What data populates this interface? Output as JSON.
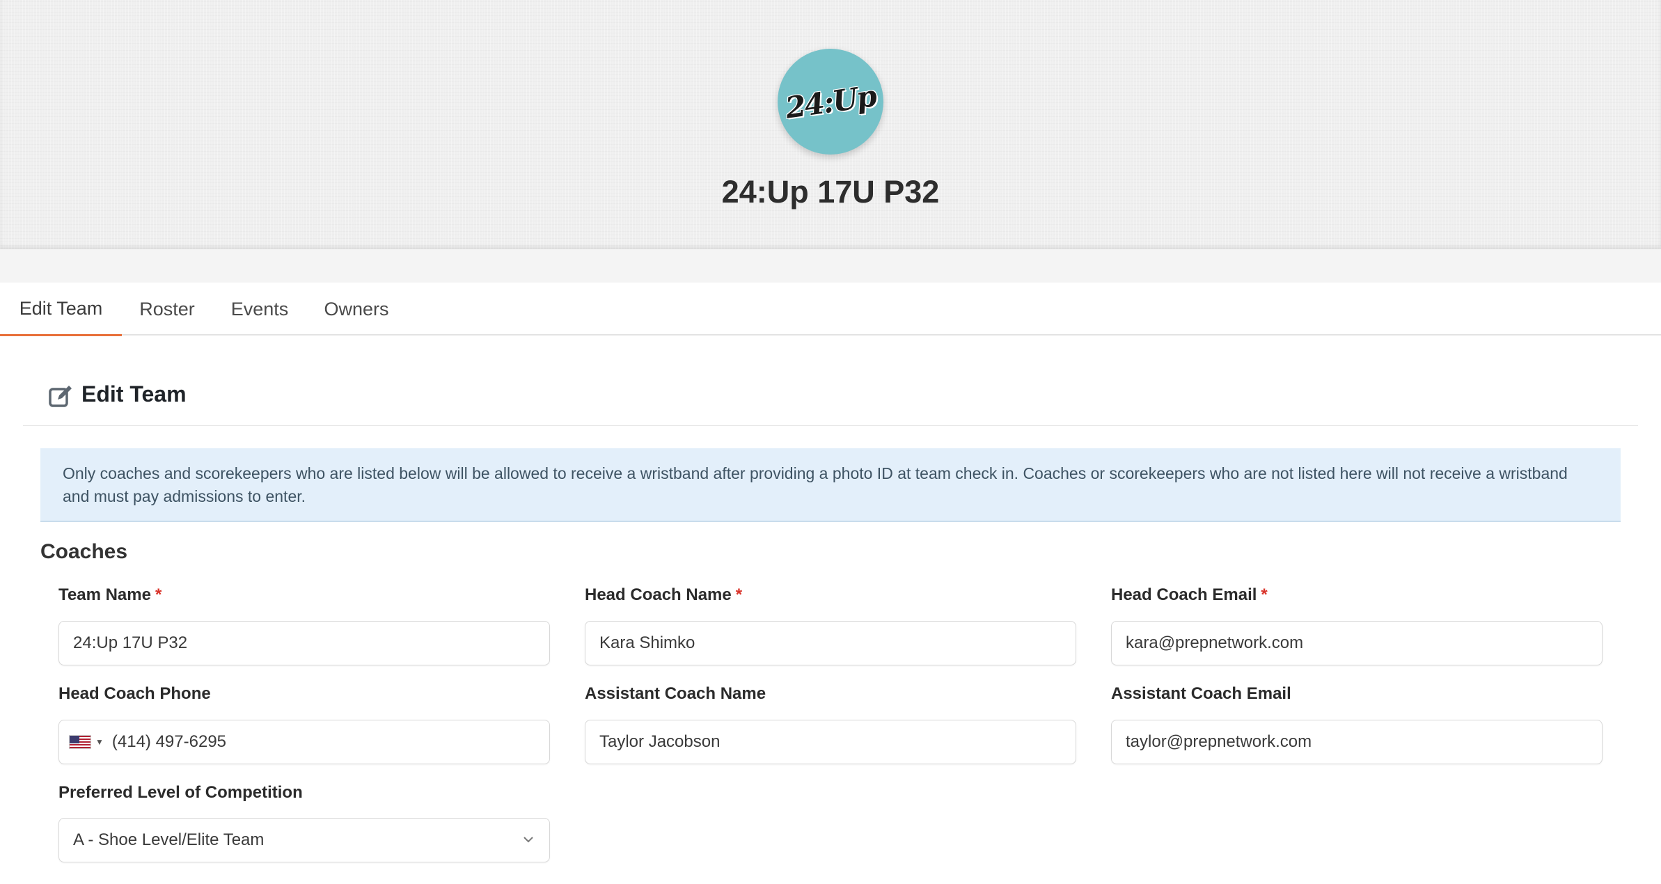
{
  "team": {
    "logo_text": "24:Up",
    "title": "24:Up 17U P32"
  },
  "tabs": [
    {
      "label": "Edit Team",
      "active": true
    },
    {
      "label": "Roster",
      "active": false
    },
    {
      "label": "Events",
      "active": false
    },
    {
      "label": "Owners",
      "active": false
    }
  ],
  "section": {
    "title": "Edit Team",
    "icon": "edit-icon"
  },
  "alert": {
    "text": "Only coaches and scorekeepers who are listed below will be allowed to receive a wristband after providing a photo ID at team check in. Coaches or scorekeepers who are not listed here will not receive a wristband and must pay admissions to enter."
  },
  "coaches": {
    "title": "Coaches",
    "required_mark": "*",
    "fields": {
      "team_name": {
        "label": "Team Name",
        "value": "24:Up 17U P32",
        "required": true
      },
      "head_coach_name": {
        "label": "Head Coach Name",
        "value": "Kara Shimko",
        "required": true
      },
      "head_coach_email": {
        "label": "Head Coach Email",
        "value": "kara@prepnetwork.com",
        "required": true
      },
      "head_coach_phone": {
        "label": "Head Coach Phone",
        "value": "(414) 497-6295",
        "country": "us-flag-icon"
      },
      "assistant_coach_name": {
        "label": "Assistant Coach Name",
        "value": "Taylor Jacobson"
      },
      "assistant_coach_email": {
        "label": "Assistant Coach Email",
        "value": "taylor@prepnetwork.com"
      },
      "competition_level": {
        "label": "Preferred Level of Competition",
        "value": "A - Shoe Level/Elite Team"
      }
    }
  },
  "colors": {
    "accent": "#e8703a",
    "logo_bg": "#76c2c9",
    "alert_bg": "#e3effa",
    "required": "#d9342b"
  }
}
